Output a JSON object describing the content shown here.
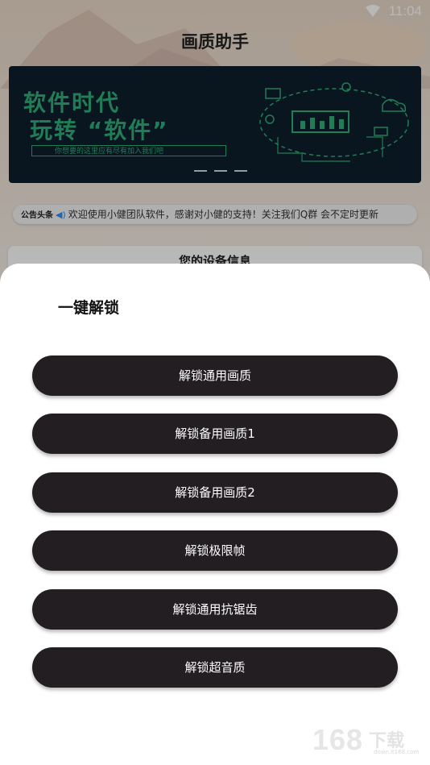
{
  "status_bar": {
    "time": "11:04"
  },
  "app": {
    "title": "画质助手"
  },
  "banner": {
    "line1": "软件时代",
    "line2": "玩转 “软件”",
    "subtitle": "你想要的这里应有尽有加入我们吧"
  },
  "notice": {
    "label": "公告头条",
    "text": "欢迎使用小健团队软件，感谢对小健的支持！关注我们Q群 会不定时更新"
  },
  "device_card": {
    "title": "您的设备信息"
  },
  "sheet": {
    "title": "一键解锁",
    "buttons": [
      {
        "label": "解锁通用画质"
      },
      {
        "label": "解锁备用画质1"
      },
      {
        "label": "解锁备用画质2"
      },
      {
        "label": "解锁极限帧"
      },
      {
        "label": "解锁通用抗锯齿"
      },
      {
        "label": "解锁超音质"
      }
    ]
  },
  "watermark": {
    "digits": "168",
    "text": "下载",
    "url": "down.it168.com"
  },
  "colors": {
    "button_bg": "#221e21",
    "banner_green": "#2fae78",
    "banner_bg": "#0d1e2b"
  }
}
